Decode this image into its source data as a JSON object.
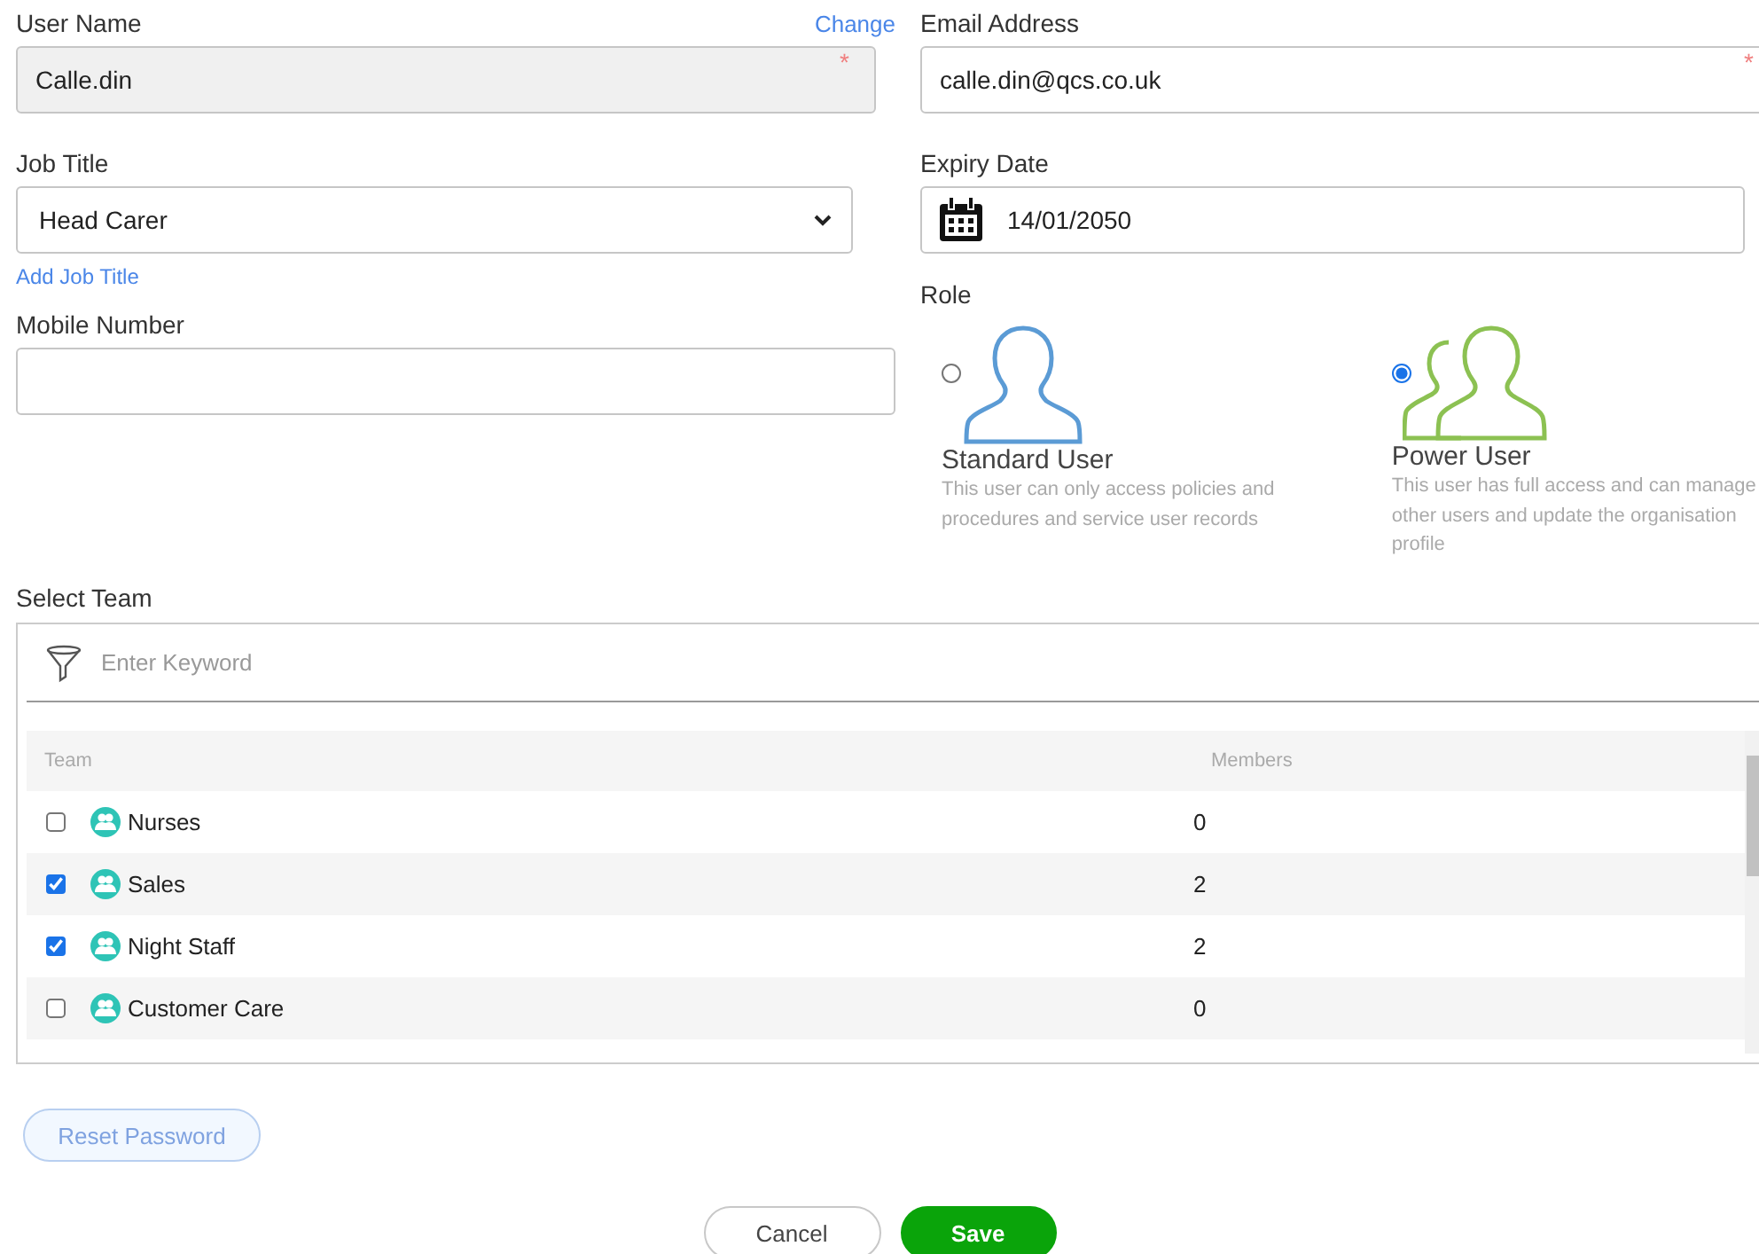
{
  "user_name": {
    "label": "User Name",
    "link": "Change",
    "value": "Calle.din",
    "required_mark": "*",
    "disabled": true
  },
  "email": {
    "label": "Email Address",
    "value": "calle.din@qcs.co.uk",
    "required_mark": "*",
    "disabled": false
  },
  "job_title": {
    "label": "Job Title",
    "value": "Head Carer",
    "link": "Add Job Title"
  },
  "expiry_date": {
    "label": "Expiry Date",
    "value": "14/01/2050"
  },
  "mobile_number": {
    "label": "Mobile Number"
  },
  "role": {
    "label": "Role",
    "options": [
      {
        "kind": "single",
        "title": "Standard User",
        "description": "This user can only access policies and procedures and service user records",
        "selected": false
      },
      {
        "kind": "group",
        "title": "Power User",
        "description": "This user has full access and can manage other users and update the organisation profile",
        "selected": true
      }
    ]
  },
  "team": {
    "label": "Select Team",
    "search": {
      "placeholder": "Enter Keyword"
    },
    "columns": [
      "Team",
      "Members"
    ],
    "rows": [
      {
        "name": "Nurses",
        "members": "0",
        "checked": false
      },
      {
        "name": "Sales",
        "members": "2",
        "checked": true
      },
      {
        "name": "Night Staff",
        "members": "2",
        "checked": true
      },
      {
        "name": "Customer Care",
        "members": "0",
        "checked": false
      }
    ]
  },
  "buttons": [
    {
      "kind": "light",
      "label": "Reset Password"
    },
    {
      "kind": "outline",
      "label": "Cancel"
    },
    {
      "kind": "primary",
      "label": "Save"
    }
  ]
}
